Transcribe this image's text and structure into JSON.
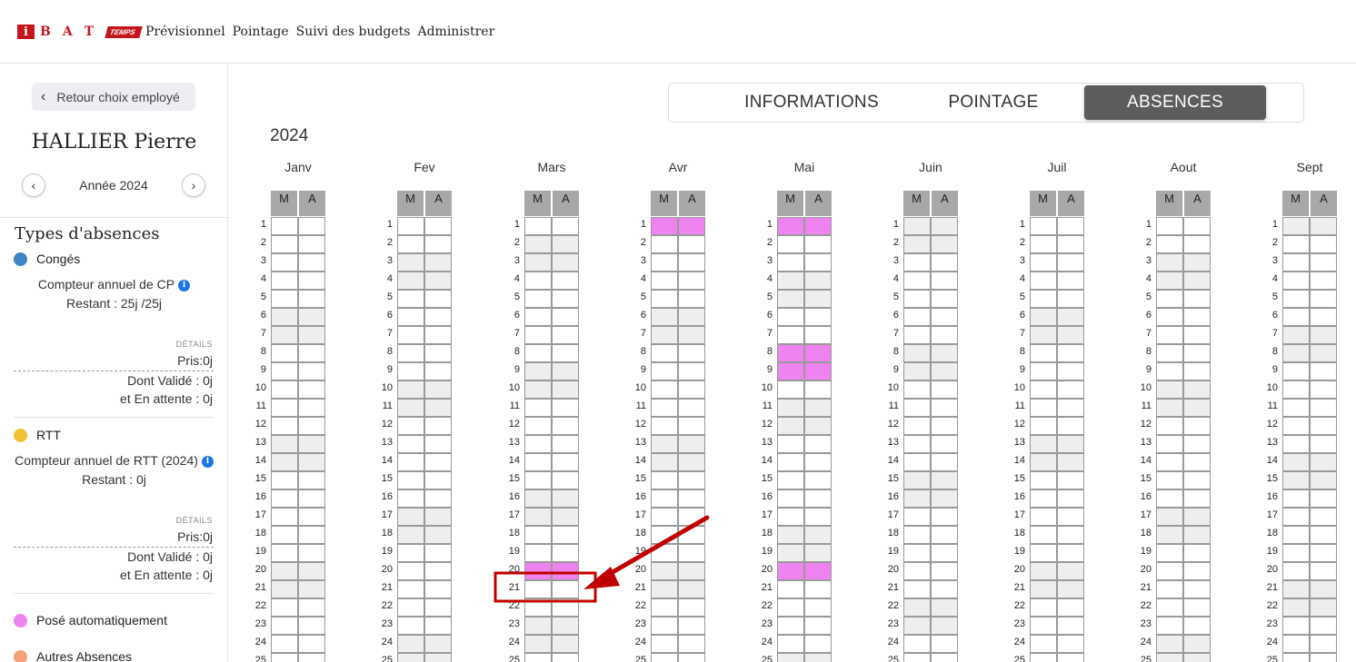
{
  "app": {
    "logo_i": "i",
    "logo_letters": [
      "B",
      "A",
      "T"
    ],
    "logo_badge": "TEMPS",
    "nav": [
      "Prévisionnel",
      "Pointage",
      "Suivi des budgets",
      "Administrer"
    ]
  },
  "sidebar": {
    "back_label": "Retour choix employé",
    "employee_name": "HALLIER Pierre",
    "year_label": "Année 2024",
    "types_title": "Types d'absences",
    "conges": {
      "label": "Congés",
      "color": "#3d85c6",
      "counter": "Compteur annuel de CP",
      "remaining": "Restant : 25j /25j",
      "details": "DÉTAILS",
      "taken": "Pris:0j",
      "validated": "Dont Validé : 0j",
      "pending": "et En attente : 0j"
    },
    "rtt": {
      "label": "RTT",
      "color": "#f1c232",
      "counter": "Compteur annuel de RTT (2024)",
      "remaining": "Restant : 0j",
      "details": "DÉTAILS",
      "taken": "Pris:0j",
      "validated": "Dont Validé : 0j",
      "pending": "et En attente : 0j"
    },
    "auto": {
      "label": "Posé automatiquement",
      "color": "#ee82ee"
    },
    "other": {
      "label": "Autres Absences",
      "color": "#f6a07a"
    }
  },
  "tabs": [
    "INFORMATIONS",
    "POINTAGE",
    "ABSENCES"
  ],
  "active_tab": "ABSENCES",
  "calendar": {
    "year": "2024",
    "morning_label": "M",
    "afternoon_label": "A",
    "months": [
      {
        "name": "Janv",
        "weekends": [
          6,
          7,
          13,
          14,
          20,
          21
        ],
        "auto": {}
      },
      {
        "name": "Fev",
        "weekends": [
          3,
          4,
          10,
          11,
          17,
          18,
          24,
          25
        ],
        "auto": {}
      },
      {
        "name": "Mars",
        "weekends": [
          2,
          3,
          9,
          10,
          16,
          17,
          23,
          24
        ],
        "auto": {
          "20": "both"
        }
      },
      {
        "name": "Avr",
        "weekends": [
          6,
          7,
          13,
          14,
          20,
          21
        ],
        "auto": {
          "1": "both"
        }
      },
      {
        "name": "Mai",
        "weekends": [
          4,
          5,
          11,
          12,
          18,
          19,
          25
        ],
        "auto": {
          "1": "both",
          "8": "both",
          "9": "both",
          "20": "both"
        }
      },
      {
        "name": "Juin",
        "weekends": [
          1,
          2,
          8,
          9,
          15,
          16,
          22,
          23
        ],
        "auto": {}
      },
      {
        "name": "Juil",
        "weekends": [
          6,
          7,
          13,
          14,
          20,
          21
        ],
        "auto": {}
      },
      {
        "name": "Aout",
        "weekends": [
          3,
          4,
          10,
          11,
          17,
          18,
          24,
          25
        ],
        "auto": {}
      },
      {
        "name": "Sept",
        "weekends": [
          1,
          7,
          8,
          14,
          15,
          21,
          22
        ],
        "auto": {}
      }
    ]
  },
  "colors": {
    "brand": "#c4161c",
    "tab_active": "#5c5c5c",
    "weekend": "#eeeeee",
    "auto": "#ee82ee",
    "annotation": "#c00000"
  }
}
